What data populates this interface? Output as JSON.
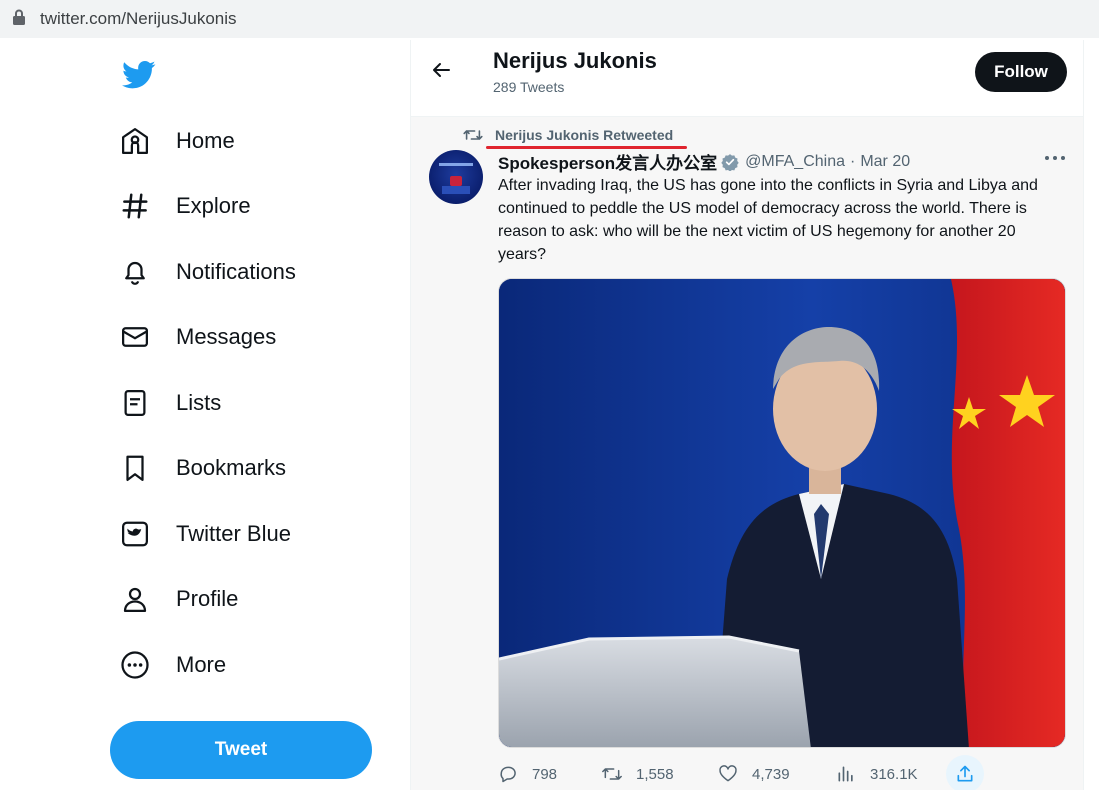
{
  "browser": {
    "url": "twitter.com/NerijusJukonis"
  },
  "sidebar": {
    "items": [
      {
        "label": "Home",
        "icon": "home-icon"
      },
      {
        "label": "Explore",
        "icon": "hashtag-icon"
      },
      {
        "label": "Notifications",
        "icon": "bell-icon"
      },
      {
        "label": "Messages",
        "icon": "envelope-icon"
      },
      {
        "label": "Lists",
        "icon": "list-icon"
      },
      {
        "label": "Bookmarks",
        "icon": "bookmark-icon"
      },
      {
        "label": "Twitter Blue",
        "icon": "twitter-blue-icon"
      },
      {
        "label": "Profile",
        "icon": "person-icon"
      },
      {
        "label": "More",
        "icon": "more-circle-icon"
      }
    ],
    "tweet_button": "Tweet"
  },
  "header": {
    "name": "Nerijus Jukonis",
    "tweet_count": "289 Tweets",
    "follow_label": "Follow"
  },
  "tweet": {
    "retweeted_by": "Nerijus Jukonis Retweeted",
    "author": "Spokesperson发言人办公室",
    "handle": "@MFA_China",
    "separator": "·",
    "date": "Mar 20",
    "text": "After invading Iraq, the US has gone into the conflicts in Syria and Libya and continued to peddle the US model of democracy across the world. There is reason to ask: who will be the next victim of US hegemony for another 20 years?",
    "stats": {
      "replies": "798",
      "retweets": "1,558",
      "likes": "4,739",
      "views": "316.1K"
    }
  },
  "colors": {
    "brand": "#1d9bf0",
    "text": "#0f1419",
    "muted": "#536471",
    "annotation": "#e0242e"
  }
}
